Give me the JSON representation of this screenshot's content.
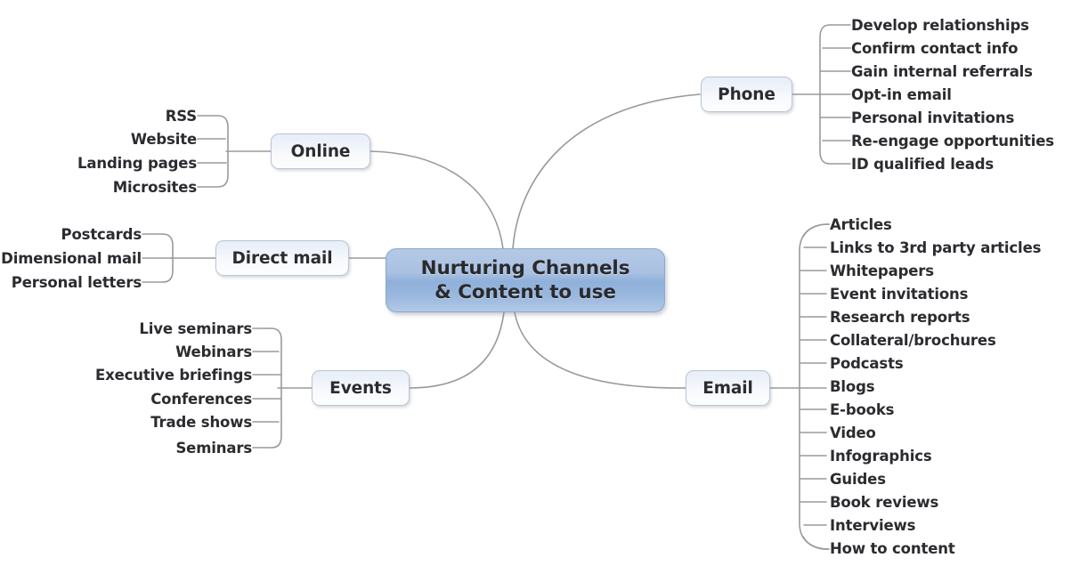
{
  "diagram": {
    "type": "mind-map",
    "title": "Nurturing Channels & Content to use",
    "background": "#ffffff",
    "colors": {
      "central_fill_top": "#b4c9e5",
      "central_fill_bottom": "#8fb0da",
      "branch_fill_top": "#e8eef7",
      "branch_fill_bottom": "#fcfdfe",
      "connector": "#9a9a9a",
      "text": "#2b2b30"
    }
  },
  "center": {
    "line1": "Nurturing Channels",
    "line2": "& Content to use"
  },
  "branches": [
    {
      "id": "phone",
      "label": "Phone",
      "side": "right",
      "children": [
        "Develop relationships",
        "Confirm contact info",
        "Gain internal referrals",
        "Opt-in email",
        "Personal invitations",
        "Re-engage opportunities",
        "ID qualified leads"
      ]
    },
    {
      "id": "online",
      "label": "Online",
      "side": "left",
      "children": [
        "RSS",
        "Website",
        "Landing pages",
        "Microsites"
      ]
    },
    {
      "id": "direct-mail",
      "label": "Direct mail",
      "side": "left",
      "children": [
        "Postcards",
        "Dimensional mail",
        "Personal letters"
      ]
    },
    {
      "id": "events",
      "label": "Events",
      "side": "left",
      "children": [
        "Live seminars",
        "Webinars",
        "Executive briefings",
        "Conferences",
        "Trade shows",
        "Seminars"
      ]
    },
    {
      "id": "email",
      "label": "Email",
      "side": "right",
      "children": [
        "Articles",
        "Links to 3rd party articles",
        "Whitepapers",
        "Event invitations",
        "Research reports",
        "Collateral/brochures",
        "Podcasts",
        "Blogs",
        "E-books",
        "Video",
        "Infographics",
        "Guides",
        "Book reviews",
        "Interviews",
        "How to content"
      ]
    }
  ]
}
